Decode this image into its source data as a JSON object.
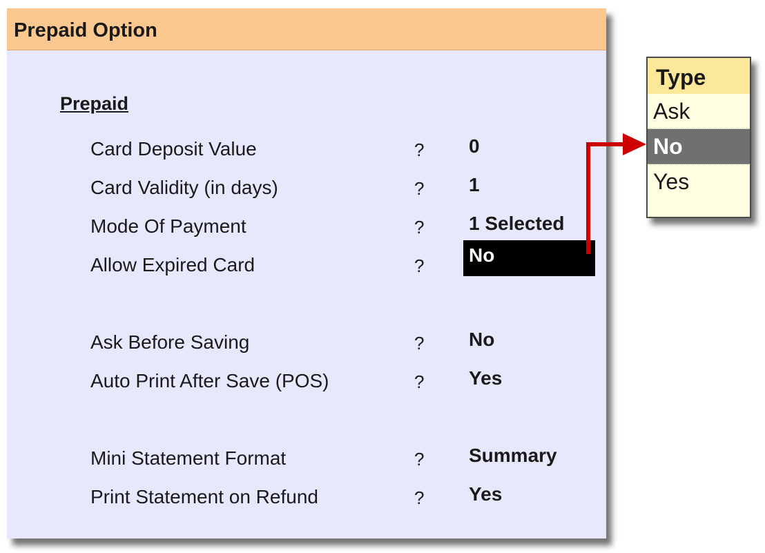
{
  "window": {
    "title": "Prepaid Option"
  },
  "section": {
    "heading": "Prepaid"
  },
  "fields": [
    {
      "label": "Card Deposit Value",
      "q": "?",
      "value": "0"
    },
    {
      "label": "Card Validity (in days)",
      "q": "?",
      "value": "1"
    },
    {
      "label": "Mode Of Payment",
      "q": "?",
      "value": "1 Selected"
    },
    {
      "label": "Allow Expired Card",
      "q": "?",
      "value": "No"
    },
    {
      "label": "Ask Before Saving",
      "q": "?",
      "value": "No"
    },
    {
      "label": "Auto Print After Save (POS)",
      "q": "?",
      "value": "Yes"
    },
    {
      "label": "Mini Statement Format",
      "q": "?",
      "value": "Summary"
    },
    {
      "label": "Print Statement on Refund",
      "q": "?",
      "value": "Yes"
    }
  ],
  "selected_field_index": 3,
  "popup": {
    "title": "Type",
    "options": [
      "Ask",
      "No",
      "Yes"
    ],
    "highlighted_option": "No"
  },
  "colors": {
    "header_bg": "#fcc890",
    "panel_bg": "#e8e8fc",
    "arrow": "#cc0000",
    "popup_bg": "#fefee0",
    "popup_title_bg": "#fce89a",
    "highlight_bg": "#707070"
  },
  "icons": {
    "arrow": "red-connector-arrow"
  }
}
